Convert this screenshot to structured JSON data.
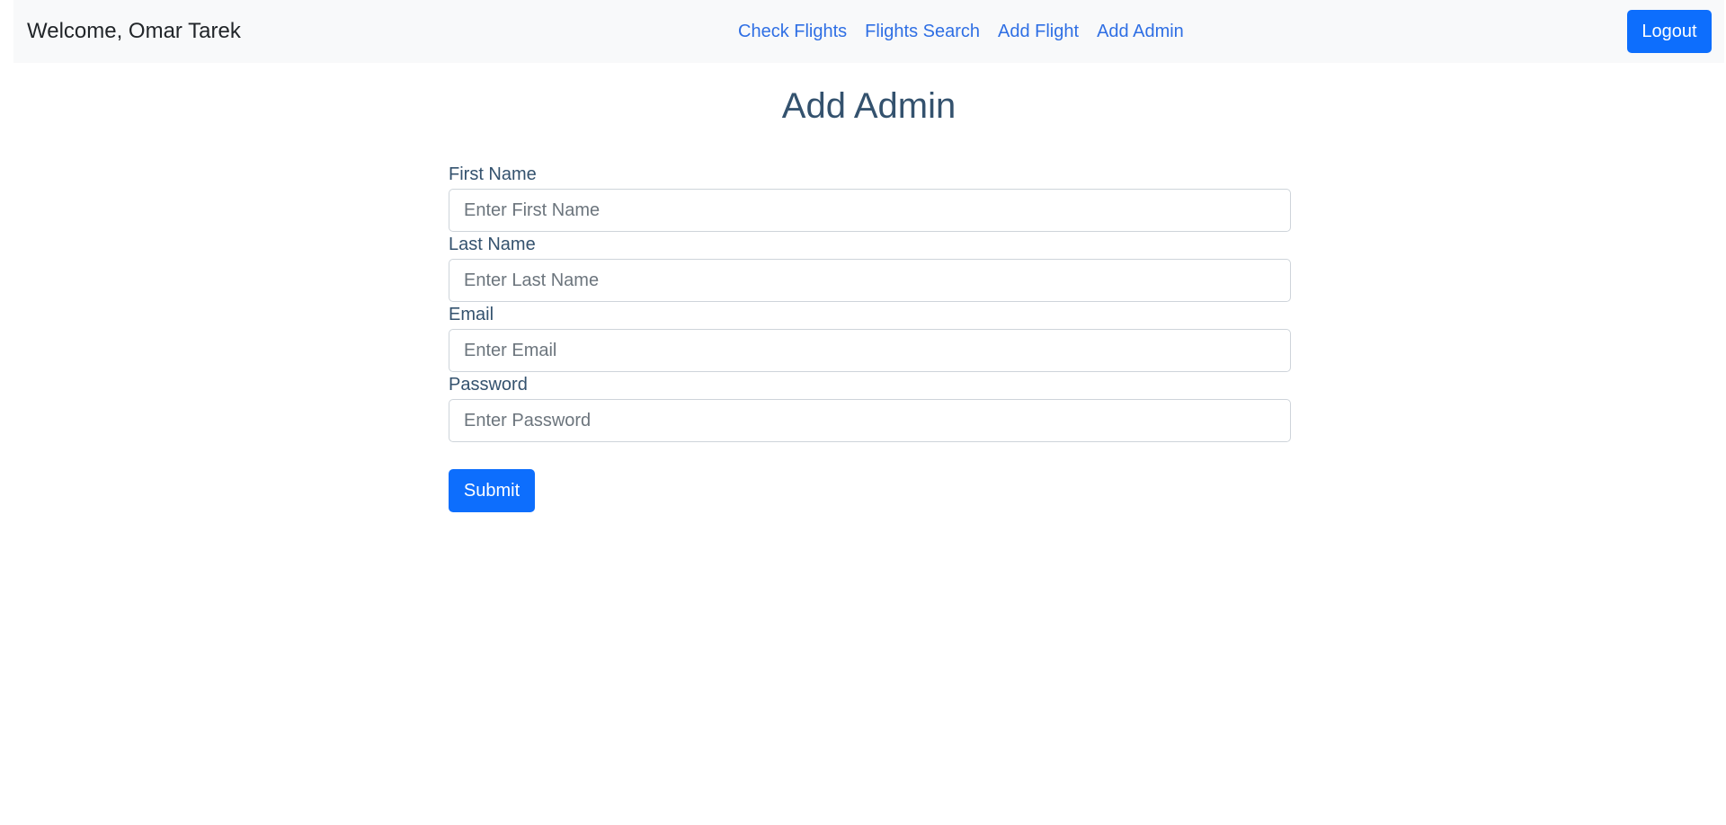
{
  "navbar": {
    "welcome": "Welcome, Omar Tarek",
    "links": [
      {
        "label": "Check Flights"
      },
      {
        "label": "Flights Search"
      },
      {
        "label": "Add Flight"
      },
      {
        "label": "Add Admin"
      }
    ],
    "logout_label": "Logout"
  },
  "page": {
    "title": "Add Admin"
  },
  "form": {
    "fields": [
      {
        "label": "First Name",
        "placeholder": "Enter First Name",
        "value": ""
      },
      {
        "label": "Last Name",
        "placeholder": "Enter Last Name",
        "value": ""
      },
      {
        "label": "Email",
        "placeholder": "Enter Email",
        "value": ""
      },
      {
        "label": "Password",
        "placeholder": "Enter Password",
        "value": ""
      }
    ],
    "submit_label": "Submit"
  },
  "colors": {
    "primary": "#0d6efd",
    "link": "#2f6fe4",
    "heading": "#34526e",
    "navbar_bg": "#f8f9fa"
  }
}
